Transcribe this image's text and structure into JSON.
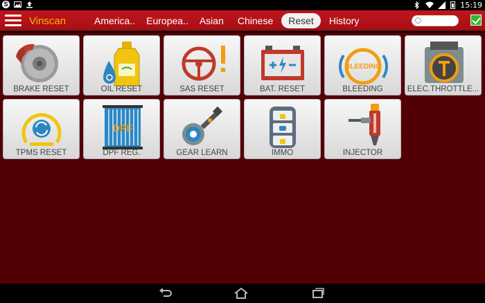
{
  "status_bar": {
    "left_icons": [
      "skype-icon",
      "image-icon",
      "upload-icon"
    ],
    "right_icons": [
      "bluetooth-icon",
      "wifi-icon",
      "signal-icon",
      "battery-icon"
    ],
    "time": "15:19"
  },
  "header": {
    "app_title": "Vinscan",
    "tabs": [
      {
        "label": "America.."
      },
      {
        "label": "Europea.."
      },
      {
        "label": "Asian"
      },
      {
        "label": "Chinese"
      },
      {
        "label": "Reset",
        "active": true
      },
      {
        "label": "History"
      }
    ],
    "search_value": "",
    "search_placeholder": ""
  },
  "tiles": [
    {
      "label": "BRAKE RESET",
      "icon": "brake-disc-icon"
    },
    {
      "label": "OIL RESET",
      "icon": "oil-bottle-icon"
    },
    {
      "label": "SAS RESET",
      "icon": "steering-wheel-icon"
    },
    {
      "label": "BAT. RESET",
      "icon": "battery-icon"
    },
    {
      "label": "BLEEDING",
      "icon": "bleeding-icon"
    },
    {
      "label": "ELEC.THROTTLE...",
      "icon": "throttle-icon"
    },
    {
      "label": "TPMS RESET",
      "icon": "tpms-icon"
    },
    {
      "label": "DPF REG.",
      "icon": "dpf-filter-icon"
    },
    {
      "label": "GEAR LEARN",
      "icon": "gear-sensor-icon"
    },
    {
      "label": "IMMO",
      "icon": "immobilizer-key-icon"
    },
    {
      "label": "INJECTOR",
      "icon": "injector-icon"
    }
  ],
  "icon_text": {
    "bleeding": "BLEEDING",
    "dpf": "DPF"
  },
  "colors": {
    "header": "#b8121a",
    "background": "#520005",
    "title_accent": "#ffb400",
    "tile": "#ececec"
  },
  "nav_bar": [
    "back-icon",
    "home-icon",
    "recent-apps-icon"
  ]
}
